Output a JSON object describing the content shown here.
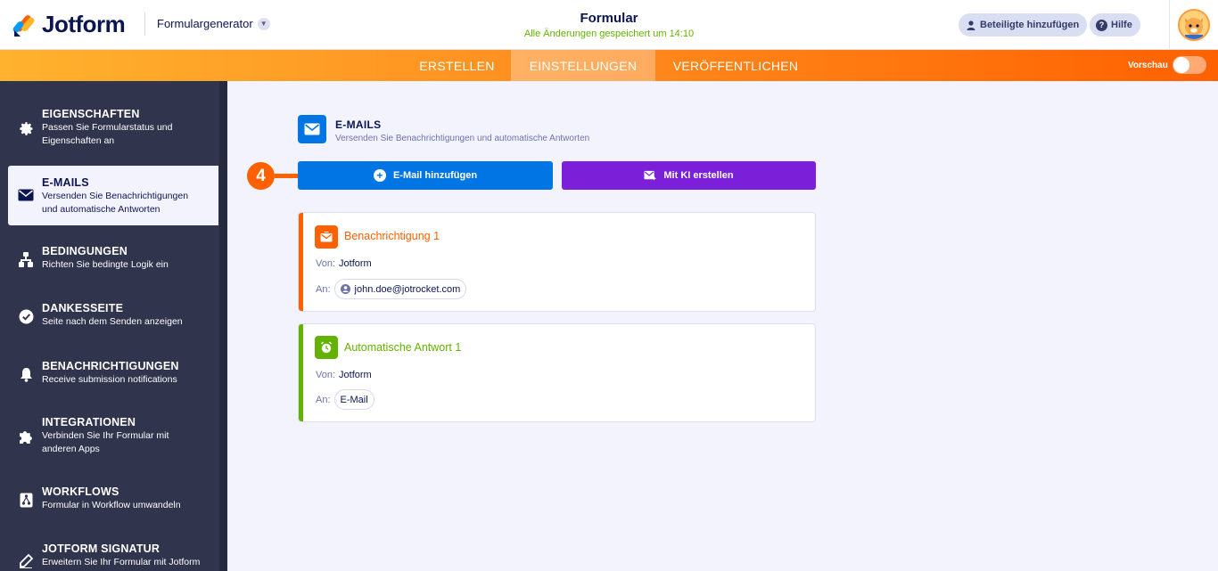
{
  "header": {
    "logo_text": "Jotform",
    "app_switcher": "Formulargenerator",
    "form_title": "Formular",
    "save_status": "Alle Änderungen gespeichert um 14:10",
    "add_participants": "Beteiligte hinzufügen",
    "help": "Hilfe"
  },
  "nav": {
    "tabs": [
      "ERSTELLEN",
      "EINSTELLUNGEN",
      "VERÖFFENTLICHEN"
    ],
    "active_tab": "EINSTELLUNGEN",
    "preview_label": "Vorschau"
  },
  "sidebar": {
    "items": [
      {
        "icon": "gear-icon",
        "title": "EIGENSCHAFTEN",
        "desc": "Passen Sie Formularstatus und\nEigenschaften an"
      },
      {
        "icon": "envelope-icon",
        "title": "E-MAILS",
        "desc": "Versenden Sie Benachrichtigungen\nund automatische Antworten",
        "active": true
      },
      {
        "icon": "conditions-icon",
        "title": "BEDINGUNGEN",
        "desc": "Richten Sie bedingte Logik ein"
      },
      {
        "icon": "check-circle-icon",
        "title": "DANKESSEITE",
        "desc": "Seite nach dem Senden anzeigen"
      },
      {
        "icon": "bell-icon",
        "title": "BENACHRICHTIGUNGEN",
        "desc": "Receive submission notifications"
      },
      {
        "icon": "puzzle-icon",
        "title": "INTEGRATIONEN",
        "desc": "Verbinden Sie Ihr Formular mit\nanderen Apps"
      },
      {
        "icon": "workflow-icon",
        "title": "WORKFLOWS",
        "desc": "Formular in Workflow umwandeln"
      },
      {
        "icon": "signature-icon",
        "title": "JOTFORM SIGNATUR",
        "desc": "Erweitern Sie Ihr Formular mit Jotform"
      }
    ]
  },
  "main": {
    "section_title": "E-MAILS",
    "section_desc": "Versenden Sie Benachrichtigungen und automatische Antworten",
    "step_number": "4",
    "add_email_button": "E-Mail hinzufügen",
    "ai_button": "Mit KI erstellen",
    "cards": [
      {
        "title": "Benachrichtigung 1",
        "from_label": "Von:",
        "from_value": "Jotform",
        "to_label": "An:",
        "to_value": "john.doe@jotrocket.com",
        "color": "#ff6100"
      },
      {
        "title": "Automatische Antwort 1",
        "from_label": "Von:",
        "from_value": "Jotform",
        "to_label": "An:",
        "to_value": "E-Mail",
        "color": "#64b200"
      }
    ]
  },
  "colors": {
    "brand_orange": "#ff6100",
    "primary_blue": "#0075e3",
    "ai_purple": "#7b1fd9",
    "success_green": "#64b200",
    "navy": "#0a1551"
  }
}
